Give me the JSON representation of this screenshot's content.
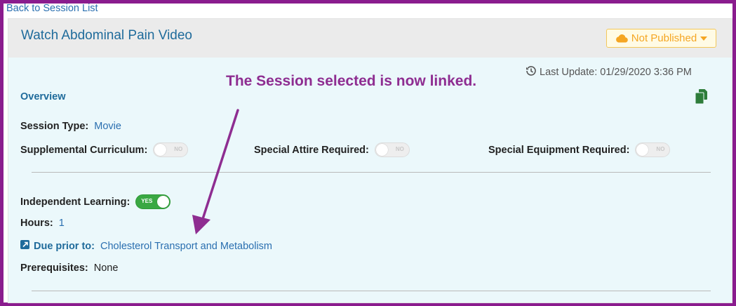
{
  "back_link": "Back to Session List",
  "session_title": "Watch Abdominal Pain Video",
  "publish_status": "Not Published",
  "last_update": "Last Update: 01/29/2020 3:36 PM",
  "overview_label": "Overview",
  "annotation": "The Session selected is now linked.",
  "session_type": {
    "label": "Session Type:",
    "value": "Movie"
  },
  "supplemental": {
    "label": "Supplemental Curriculum:",
    "toggle": "NO"
  },
  "attire": {
    "label": "Special Attire Required:",
    "toggle": "NO"
  },
  "equipment": {
    "label": "Special Equipment Required:",
    "toggle": "NO"
  },
  "independent": {
    "label": "Independent Learning:",
    "toggle": "YES"
  },
  "hours": {
    "label": "Hours:",
    "value": "1"
  },
  "due_prior": {
    "label": "Due prior to:",
    "value": "Cholesterol Transport and Metabolism"
  },
  "prerequisites": {
    "label": "Prerequisites:",
    "value": "None"
  },
  "colors": {
    "frame": "#8a1c8e",
    "annotation": "#8e2d91",
    "link": "#2a6fb0",
    "title": "#1f6b9b",
    "toggle_on": "#3aa843",
    "publish": "#f5a623"
  },
  "icons": [
    "cloud-icon",
    "caret-down-icon",
    "history-icon",
    "copy-icon",
    "external-link-icon"
  ]
}
